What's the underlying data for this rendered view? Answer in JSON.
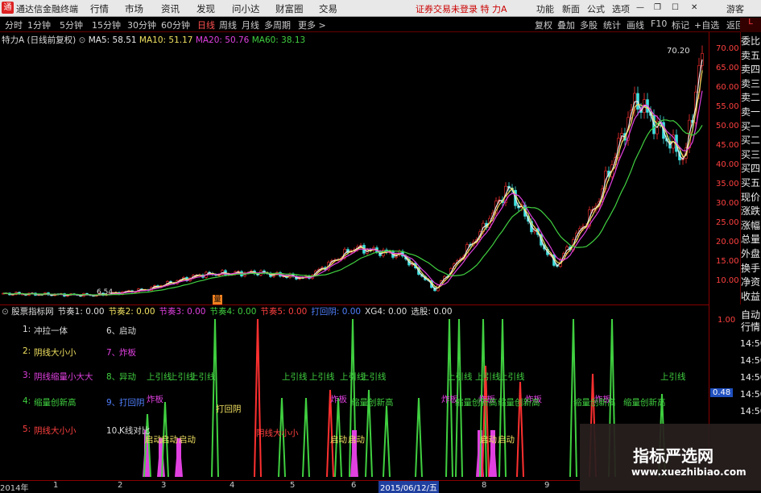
{
  "app": {
    "name": "通达信金融终端",
    "logo": "通"
  },
  "menu": [
    "行情",
    "市场",
    "资讯",
    "发现",
    "问小达",
    "财富圈",
    "交易"
  ],
  "trade_status": "证券交易未登录  特 力A",
  "sys_buttons": [
    "功能",
    "新面",
    "公式",
    "选项",
    "游客"
  ],
  "periods": [
    "分时",
    "1分钟",
    "5分钟",
    "15分钟",
    "30分钟",
    "60分钟",
    "日线",
    "周线",
    "月线",
    "多周期",
    "更多 >"
  ],
  "active_period": "日线",
  "tools": [
    "复权",
    "叠加",
    "多股",
    "统计",
    "画线",
    "F10",
    "标记",
    "+自选",
    "返回"
  ],
  "stock_title": "特力A (日线前复权)",
  "ma": [
    {
      "label": "MA5: 58.51",
      "color": "#e8e8e8"
    },
    {
      "label": "MA10: 51.17",
      "color": "#f0e060"
    },
    {
      "label": "MA20: 50.76",
      "color": "#e040e0"
    },
    {
      "label": "MA60: 38.13",
      "color": "#40d040"
    }
  ],
  "price_axis": [
    "70.00",
    "65.00",
    "60.00",
    "55.00",
    "50.00",
    "45.00",
    "40.00",
    "35.00",
    "30.00",
    "25.00",
    "20.00",
    "15.00",
    "10.00"
  ],
  "price_marks": {
    "high": "70.20",
    "low": "6.54",
    "chart_corner": "L",
    "right_tag": "L"
  },
  "right_tabs": [
    "委比",
    "卖五",
    "卖四",
    "卖三",
    "卖二",
    "卖一",
    "买一",
    "买二",
    "买三",
    "买四",
    "买五",
    "现价",
    "涨跌",
    "涨幅",
    "总量",
    "外盘",
    "换手",
    "净资",
    "收益"
  ],
  "right_tabs2": [
    "自动",
    "行情"
  ],
  "indicator_legend": [
    {
      "label": "股票指标网",
      "color": "#ddd"
    },
    {
      "label": "节奏1: 0.00",
      "color": "#ddd"
    },
    {
      "label": "节奏2: 0.00",
      "color": "#f0e060"
    },
    {
      "label": "节奏3: 0.00",
      "color": "#e040e0"
    },
    {
      "label": "节奏4: 0.00",
      "color": "#40d040"
    },
    {
      "label": "节奏5: 0.00",
      "color": "#ff4040"
    },
    {
      "label": "打回阴: 0.00",
      "color": "#5080ff"
    },
    {
      "label": "XG4: 0.00",
      "color": "#ddd"
    },
    {
      "label": "选股: 0.00",
      "color": "#ddd"
    }
  ],
  "ind_axis": [
    "1.00",
    "14:50",
    "14:50",
    "14:50",
    "14:50",
    "14:50"
  ],
  "ind_value_tag": "0.48",
  "legend_items": [
    {
      "n": "1:",
      "t": "冲拉一体",
      "color": "#ddd"
    },
    {
      "n": "2:",
      "t": "阴线大小小",
      "color": "#f0e060"
    },
    {
      "n": "3:",
      "t": "阴线缩量小大大",
      "color": "#e040e0"
    },
    {
      "n": "4:",
      "t": "缩量创新高",
      "color": "#40d040"
    },
    {
      "n": "5:",
      "t": "阴线大小小",
      "color": "#ff4040"
    },
    {
      "n": "6、",
      "t": "启动",
      "color": "#ddd"
    },
    {
      "n": "7、",
      "t": "炸板",
      "color": "#e040e0"
    },
    {
      "n": "8、",
      "t": "异动",
      "color": "#40d040"
    },
    {
      "n": "9、",
      "t": "打回阴",
      "color": "#5080ff"
    },
    {
      "n": "10、",
      "t": "K线对比",
      "color": "#ddd"
    }
  ],
  "signal_texts": {
    "up": "上引线",
    "start": "启动",
    "zha": "炸板",
    "shrink": "缩量创新高",
    "dahui": "打回阴",
    "yin": "阴线大小小",
    "mark": "量"
  },
  "dates": [
    "2014年",
    "1",
    "2",
    "3",
    "4",
    "5",
    "6",
    "2015/06/12/五",
    "8",
    "9"
  ],
  "watermark": {
    "cn": "指标严选网",
    "en": "www.xuezhibiao.com"
  }
}
